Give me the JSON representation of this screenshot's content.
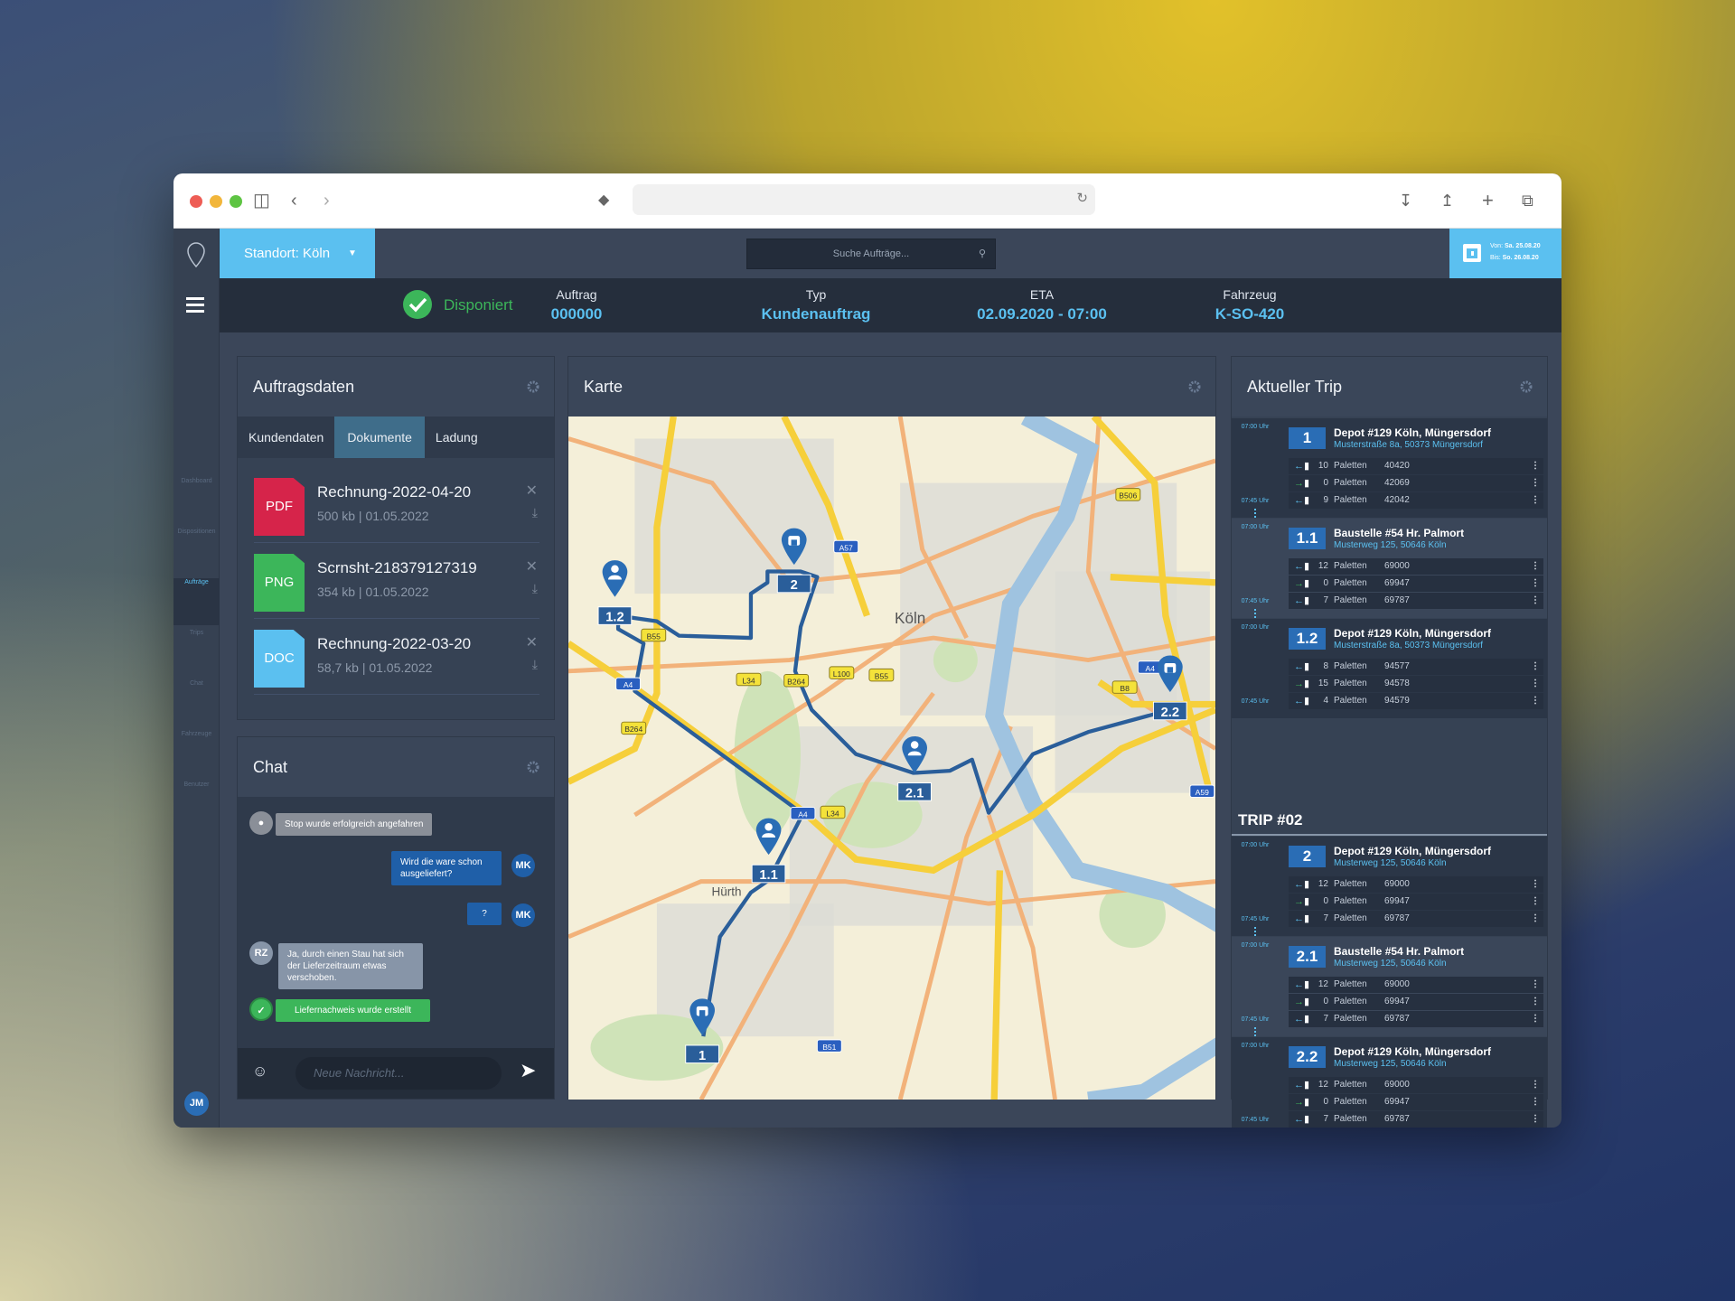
{
  "colors": {
    "accent": "#5bc0f0",
    "primary": "#2a6db5",
    "success": "#3cb65a",
    "pdf": "#d6244a",
    "png": "#3cb65a",
    "doc": "#5bc0f0"
  },
  "browser": {
    "icons": [
      "sidebar-icon",
      "back-icon",
      "forward-icon",
      "shield-icon",
      "reload-icon",
      "download-icon",
      "share-icon",
      "plus-icon",
      "tabs-icon"
    ]
  },
  "topbar": {
    "standort": "Standort: Köln",
    "search_placeholder": "Suche Aufträge...",
    "date_from_label": "Von:",
    "date_from": "Sa. 25.08.20",
    "date_to_label": "Bis:",
    "date_to": "So. 26.08.20"
  },
  "sidebar": {
    "items": [
      {
        "label": "Dashboard",
        "icon": "dashboard-icon"
      },
      {
        "label": "Dispositionen",
        "icon": "pin-icon"
      },
      {
        "label": "Aufträge",
        "icon": "orders-icon",
        "active": true
      },
      {
        "label": "Trips",
        "icon": "chart-icon"
      },
      {
        "label": "Chat",
        "icon": "chat-icon"
      },
      {
        "label": "Fahrzeuge",
        "icon": "vehicle-icon"
      },
      {
        "label": "Benutzer",
        "icon": "user-icon"
      }
    ],
    "user_initials": "JM"
  },
  "status": {
    "state": "Disponiert",
    "fields": [
      {
        "label": "Auftrag",
        "value": "000000"
      },
      {
        "label": "Typ",
        "value": "Kundenauftrag"
      },
      {
        "label": "ETA",
        "value": "02.09.2020 - 07:00"
      },
      {
        "label": "Fahrzeug",
        "value": "K-SO-420"
      }
    ]
  },
  "auftragsdaten": {
    "title": "Auftragsdaten",
    "tabs": [
      "Kundendaten",
      "Dokumente",
      "Ladung"
    ],
    "active_tab": "Dokumente",
    "documents": [
      {
        "type": "PDF",
        "name": "Rechnung-2022-04-20",
        "meta": "500 kb | 01.05.2022"
      },
      {
        "type": "PNG",
        "name": "Scrnsht-218379127319",
        "meta": "354 kb | 01.05.2022"
      },
      {
        "type": "DOC",
        "name": "Rechnung-2022-03-20",
        "meta": "58,7 kb | 01.05.2022"
      }
    ]
  },
  "chat": {
    "title": "Chat",
    "messages": [
      {
        "kind": "system",
        "icon": "location-icon",
        "text": "Stop wurde erfolgreich angefahren"
      },
      {
        "kind": "out",
        "author": "MK",
        "text": "Wird die ware schon ausgeliefert?"
      },
      {
        "kind": "out",
        "author": "MK",
        "text": "?"
      },
      {
        "kind": "in",
        "author": "RZ",
        "text": "Ja, durch einen Stau hat sich der Lieferzeitraum etwas verschoben."
      },
      {
        "kind": "success",
        "icon": "check-circle-icon",
        "text": "Liefernachweis wurde erstellt"
      }
    ],
    "input_placeholder": "Neue Nachricht..."
  },
  "karte": {
    "title": "Karte",
    "city_labels": [
      "Köln",
      "Hürth"
    ],
    "road_labels": [
      "A57",
      "B506",
      "B55",
      "L34",
      "B264",
      "L100",
      "B55",
      "A4",
      "B264",
      "A4",
      "L34",
      "B8",
      "A4",
      "A59",
      "B51"
    ],
    "markers": [
      {
        "label": "1",
        "type": "depot"
      },
      {
        "label": "1.1",
        "type": "customer"
      },
      {
        "label": "1.2",
        "type": "customer"
      },
      {
        "label": "2",
        "type": "depot"
      },
      {
        "label": "2.1",
        "type": "customer"
      },
      {
        "label": "2.2",
        "type": "depot"
      }
    ]
  },
  "trip": {
    "title": "Aktueller Trip",
    "trip2_title": "TRIP #02",
    "trip1": [
      {
        "num": "1",
        "type": "depot",
        "title": "Depot #129 Köln, Müngersdorf",
        "address": "Musterstraße 8a, 50373 Müngersdorf",
        "start": "07:00 Uhr",
        "end": "07:45 Uhr",
        "rows": [
          {
            "dir": "left",
            "count": "10",
            "unit": "Paletten",
            "id": "40420"
          },
          {
            "dir": "right",
            "count": "0",
            "unit": "Paletten",
            "id": "42069"
          },
          {
            "dir": "left",
            "count": "9",
            "unit": "Paletten",
            "id": "42042"
          }
        ]
      },
      {
        "num": "1.1",
        "type": "customer",
        "title": "Baustelle #54 Hr. Palmort",
        "address": "Musterweg 125, 50646 Köln",
        "start": "07:00 Uhr",
        "end": "07:45 Uhr",
        "rows": [
          {
            "dir": "left",
            "count": "12",
            "unit": "Paletten",
            "id": "69000"
          },
          {
            "dir": "right",
            "count": "0",
            "unit": "Paletten",
            "id": "69947"
          },
          {
            "dir": "left",
            "count": "7",
            "unit": "Paletten",
            "id": "69787"
          }
        ]
      },
      {
        "num": "1.2",
        "type": "depot",
        "title": "Depot #129 Köln, Müngersdorf",
        "address": "Musterstraße 8a, 50373 Müngersdorf",
        "start": "07:00 Uhr",
        "end": "07:45 Uhr",
        "rows": [
          {
            "dir": "left",
            "count": "8",
            "unit": "Paletten",
            "id": "94577"
          },
          {
            "dir": "right",
            "count": "15",
            "unit": "Paletten",
            "id": "94578"
          },
          {
            "dir": "left",
            "count": "4",
            "unit": "Paletten",
            "id": "94579"
          }
        ]
      }
    ],
    "trip2": [
      {
        "num": "2",
        "type": "depot",
        "title": "Depot #129 Köln, Müngersdorf",
        "address": "Musterweg 125, 50646 Köln",
        "start": "07:00 Uhr",
        "end": "07:45 Uhr",
        "rows": [
          {
            "dir": "left",
            "count": "12",
            "unit": "Paletten",
            "id": "69000"
          },
          {
            "dir": "right",
            "count": "0",
            "unit": "Paletten",
            "id": "69947"
          },
          {
            "dir": "left",
            "count": "7",
            "unit": "Paletten",
            "id": "69787"
          }
        ]
      },
      {
        "num": "2.1",
        "type": "customer",
        "title": "Baustelle #54 Hr. Palmort",
        "address": "Musterweg 125, 50646 Köln",
        "start": "07:00 Uhr",
        "end": "07:45 Uhr",
        "rows": [
          {
            "dir": "left",
            "count": "12",
            "unit": "Paletten",
            "id": "69000"
          },
          {
            "dir": "right",
            "count": "0",
            "unit": "Paletten",
            "id": "69947"
          },
          {
            "dir": "left",
            "count": "7",
            "unit": "Paletten",
            "id": "69787"
          }
        ]
      },
      {
        "num": "2.2",
        "type": "depot",
        "title": "Depot #129 Köln, Müngersdorf",
        "address": "Musterweg 125, 50646 Köln",
        "start": "07:00 Uhr",
        "end": "07:45 Uhr",
        "rows": [
          {
            "dir": "left",
            "count": "12",
            "unit": "Paletten",
            "id": "69000"
          },
          {
            "dir": "right",
            "count": "0",
            "unit": "Paletten",
            "id": "69947"
          },
          {
            "dir": "left",
            "count": "7",
            "unit": "Paletten",
            "id": "69787"
          }
        ]
      }
    ]
  }
}
